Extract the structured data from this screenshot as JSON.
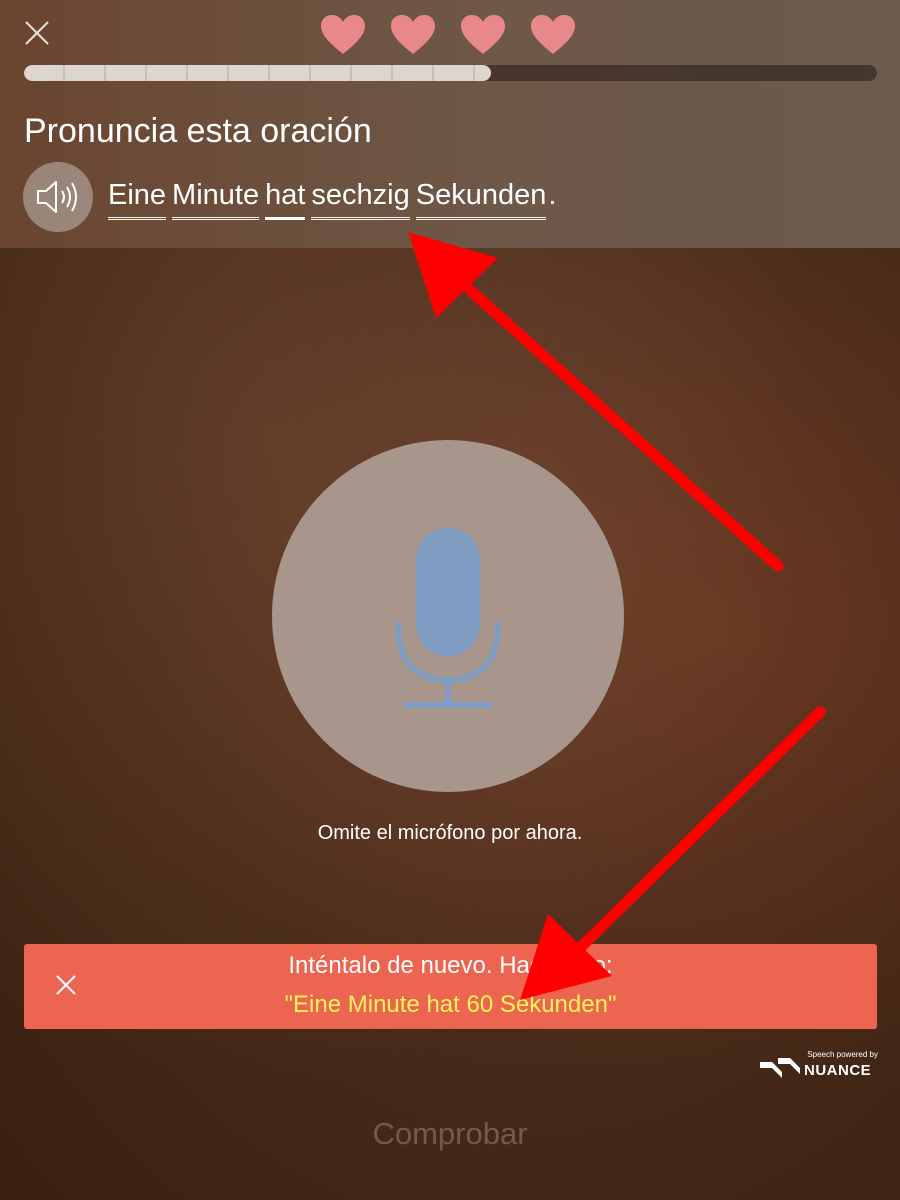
{
  "colors": {
    "heart": "#e8888b",
    "banner": "#ec6550",
    "said_text": "#fff45a",
    "mic": "#7f9cc2",
    "arrow": "#ff0000"
  },
  "header": {
    "close_icon": "close-icon",
    "lives": 4,
    "progress_fraction": 0.547
  },
  "prompt": {
    "instruction": "Pronuncia esta oración",
    "speaker_icon": "speaker-icon",
    "words": [
      "Eine",
      "Minute",
      "hat",
      "sechzig",
      "Sekunden"
    ],
    "punctuation": "."
  },
  "mic": {
    "icon": "microphone-icon",
    "skip_label": "Omite el micrófono por ahora."
  },
  "feedback": {
    "title": "Inténtalo de nuevo. Has dicho:",
    "said": "\"Eine Minute hat 60 Sekunden\"",
    "close_icon": "close-icon"
  },
  "branding": {
    "powered_by": "Speech powered by",
    "name": "NUANCE"
  },
  "footer": {
    "check_label": "Comprobar"
  }
}
